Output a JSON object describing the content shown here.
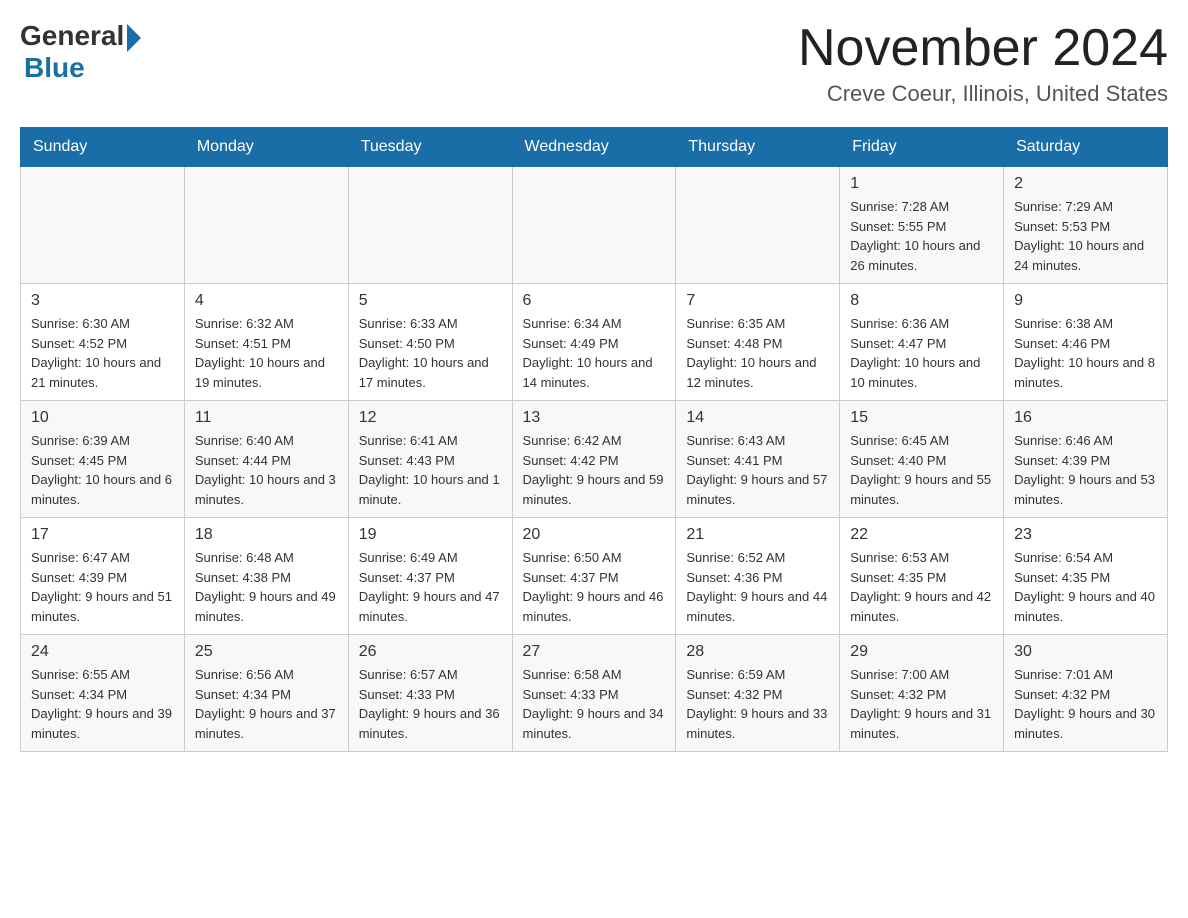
{
  "header": {
    "logo_general": "General",
    "logo_blue": "Blue",
    "month_title": "November 2024",
    "location": "Creve Coeur, Illinois, United States"
  },
  "days_of_week": [
    "Sunday",
    "Monday",
    "Tuesday",
    "Wednesday",
    "Thursday",
    "Friday",
    "Saturday"
  ],
  "weeks": [
    [
      {
        "day": "",
        "info": ""
      },
      {
        "day": "",
        "info": ""
      },
      {
        "day": "",
        "info": ""
      },
      {
        "day": "",
        "info": ""
      },
      {
        "day": "",
        "info": ""
      },
      {
        "day": "1",
        "info": "Sunrise: 7:28 AM\nSunset: 5:55 PM\nDaylight: 10 hours and 26 minutes."
      },
      {
        "day": "2",
        "info": "Sunrise: 7:29 AM\nSunset: 5:53 PM\nDaylight: 10 hours and 24 minutes."
      }
    ],
    [
      {
        "day": "3",
        "info": "Sunrise: 6:30 AM\nSunset: 4:52 PM\nDaylight: 10 hours and 21 minutes."
      },
      {
        "day": "4",
        "info": "Sunrise: 6:32 AM\nSunset: 4:51 PM\nDaylight: 10 hours and 19 minutes."
      },
      {
        "day": "5",
        "info": "Sunrise: 6:33 AM\nSunset: 4:50 PM\nDaylight: 10 hours and 17 minutes."
      },
      {
        "day": "6",
        "info": "Sunrise: 6:34 AM\nSunset: 4:49 PM\nDaylight: 10 hours and 14 minutes."
      },
      {
        "day": "7",
        "info": "Sunrise: 6:35 AM\nSunset: 4:48 PM\nDaylight: 10 hours and 12 minutes."
      },
      {
        "day": "8",
        "info": "Sunrise: 6:36 AM\nSunset: 4:47 PM\nDaylight: 10 hours and 10 minutes."
      },
      {
        "day": "9",
        "info": "Sunrise: 6:38 AM\nSunset: 4:46 PM\nDaylight: 10 hours and 8 minutes."
      }
    ],
    [
      {
        "day": "10",
        "info": "Sunrise: 6:39 AM\nSunset: 4:45 PM\nDaylight: 10 hours and 6 minutes."
      },
      {
        "day": "11",
        "info": "Sunrise: 6:40 AM\nSunset: 4:44 PM\nDaylight: 10 hours and 3 minutes."
      },
      {
        "day": "12",
        "info": "Sunrise: 6:41 AM\nSunset: 4:43 PM\nDaylight: 10 hours and 1 minute."
      },
      {
        "day": "13",
        "info": "Sunrise: 6:42 AM\nSunset: 4:42 PM\nDaylight: 9 hours and 59 minutes."
      },
      {
        "day": "14",
        "info": "Sunrise: 6:43 AM\nSunset: 4:41 PM\nDaylight: 9 hours and 57 minutes."
      },
      {
        "day": "15",
        "info": "Sunrise: 6:45 AM\nSunset: 4:40 PM\nDaylight: 9 hours and 55 minutes."
      },
      {
        "day": "16",
        "info": "Sunrise: 6:46 AM\nSunset: 4:39 PM\nDaylight: 9 hours and 53 minutes."
      }
    ],
    [
      {
        "day": "17",
        "info": "Sunrise: 6:47 AM\nSunset: 4:39 PM\nDaylight: 9 hours and 51 minutes."
      },
      {
        "day": "18",
        "info": "Sunrise: 6:48 AM\nSunset: 4:38 PM\nDaylight: 9 hours and 49 minutes."
      },
      {
        "day": "19",
        "info": "Sunrise: 6:49 AM\nSunset: 4:37 PM\nDaylight: 9 hours and 47 minutes."
      },
      {
        "day": "20",
        "info": "Sunrise: 6:50 AM\nSunset: 4:37 PM\nDaylight: 9 hours and 46 minutes."
      },
      {
        "day": "21",
        "info": "Sunrise: 6:52 AM\nSunset: 4:36 PM\nDaylight: 9 hours and 44 minutes."
      },
      {
        "day": "22",
        "info": "Sunrise: 6:53 AM\nSunset: 4:35 PM\nDaylight: 9 hours and 42 minutes."
      },
      {
        "day": "23",
        "info": "Sunrise: 6:54 AM\nSunset: 4:35 PM\nDaylight: 9 hours and 40 minutes."
      }
    ],
    [
      {
        "day": "24",
        "info": "Sunrise: 6:55 AM\nSunset: 4:34 PM\nDaylight: 9 hours and 39 minutes."
      },
      {
        "day": "25",
        "info": "Sunrise: 6:56 AM\nSunset: 4:34 PM\nDaylight: 9 hours and 37 minutes."
      },
      {
        "day": "26",
        "info": "Sunrise: 6:57 AM\nSunset: 4:33 PM\nDaylight: 9 hours and 36 minutes."
      },
      {
        "day": "27",
        "info": "Sunrise: 6:58 AM\nSunset: 4:33 PM\nDaylight: 9 hours and 34 minutes."
      },
      {
        "day": "28",
        "info": "Sunrise: 6:59 AM\nSunset: 4:32 PM\nDaylight: 9 hours and 33 minutes."
      },
      {
        "day": "29",
        "info": "Sunrise: 7:00 AM\nSunset: 4:32 PM\nDaylight: 9 hours and 31 minutes."
      },
      {
        "day": "30",
        "info": "Sunrise: 7:01 AM\nSunset: 4:32 PM\nDaylight: 9 hours and 30 minutes."
      }
    ]
  ]
}
